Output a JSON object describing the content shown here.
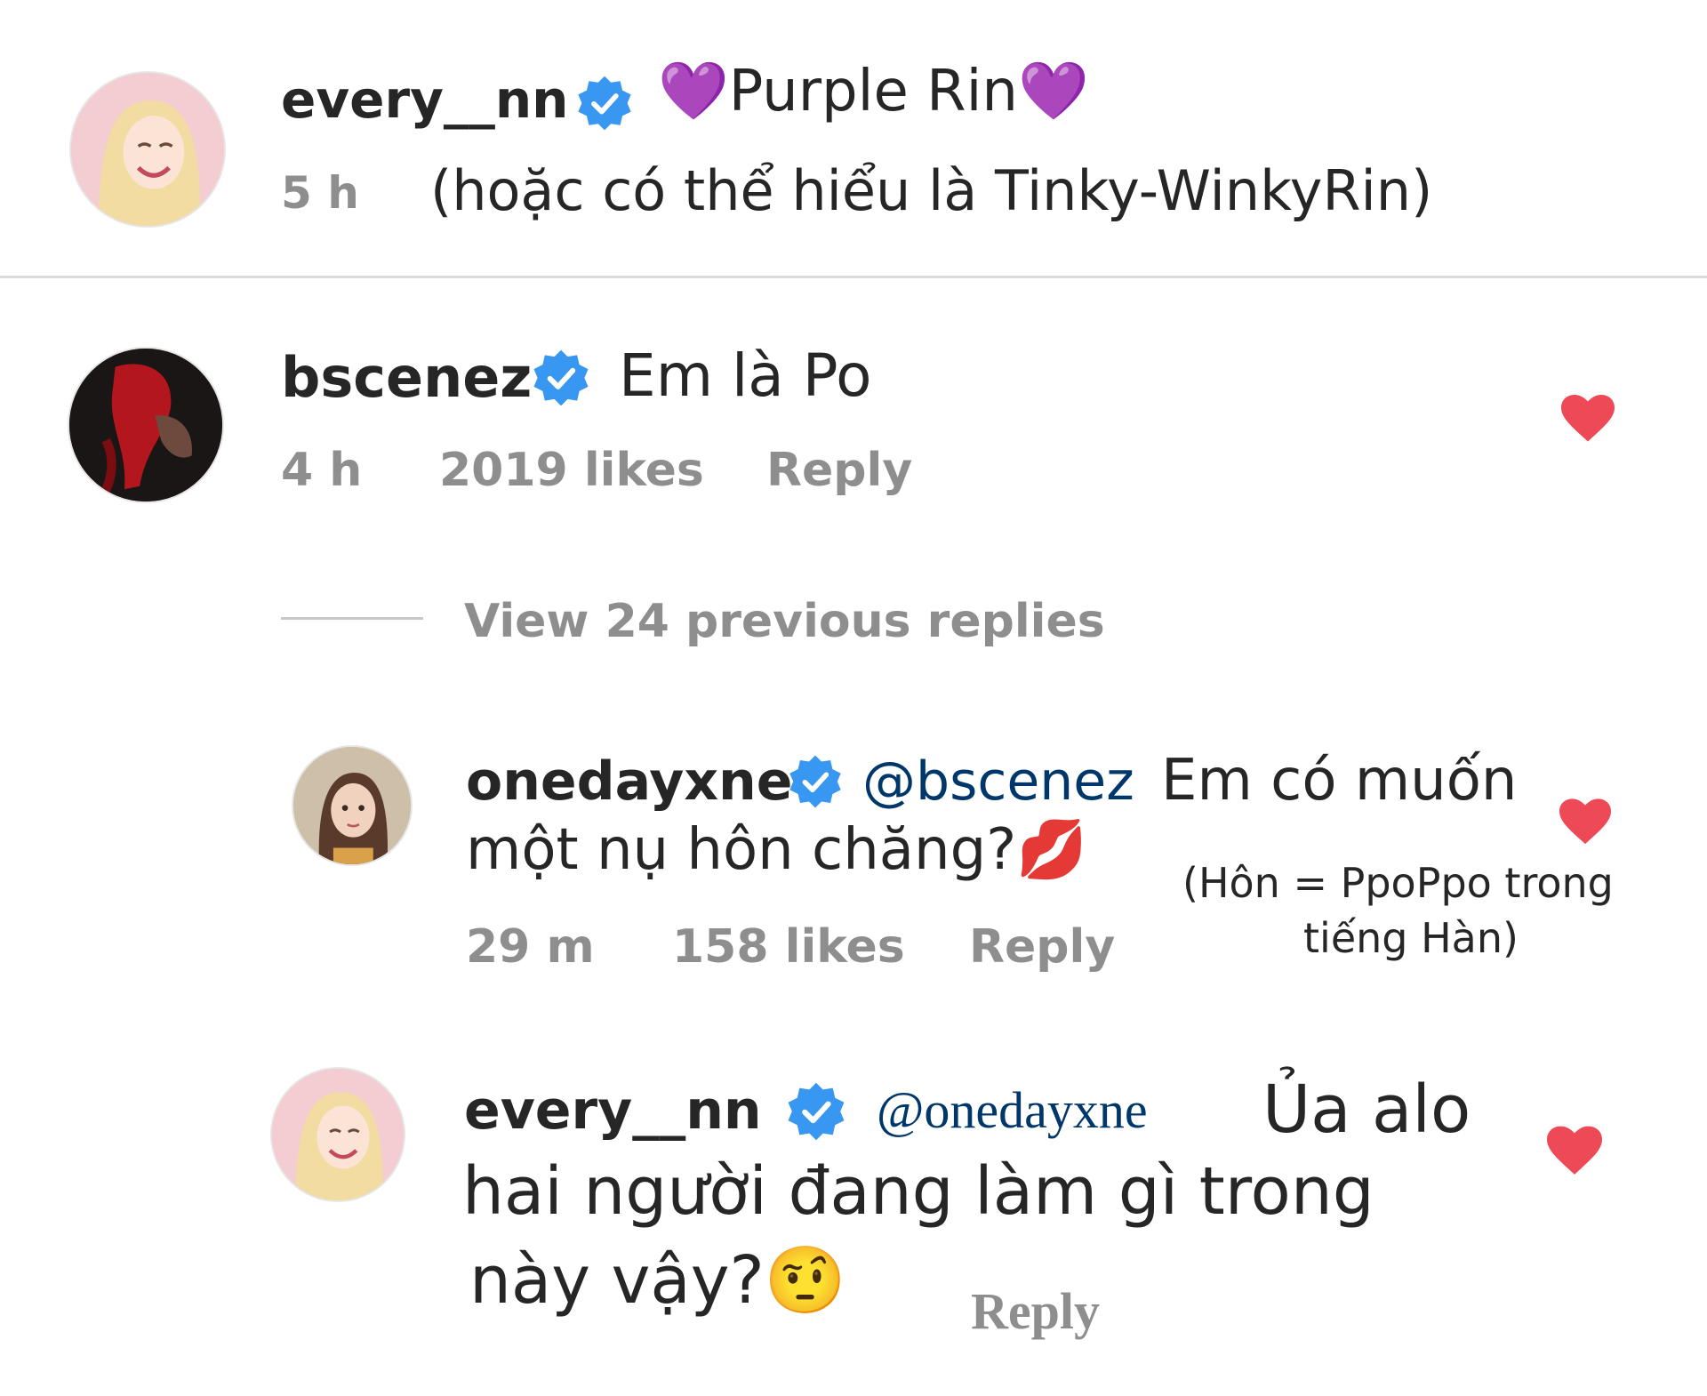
{
  "comments": [
    {
      "username": "every__nn",
      "text": "💜Purple Rin💜",
      "time": "5 h",
      "translation": "(hoặc có thể hiểu là Tinky-WinkyRin)"
    },
    {
      "username": "bscenez",
      "text": "Em là Po",
      "time": "4 h",
      "likes": "2019 likes",
      "reply_label": "Reply",
      "view_replies": "View 24 previous replies"
    }
  ],
  "replies": [
    {
      "username": "onedayxne",
      "mention": "@bscenez",
      "text_line1": "Em có muốn",
      "text_line2": "một nụ hôn chăng?💋",
      "time": "29 m",
      "likes": "158 likes",
      "reply_label": "Reply",
      "note_line1": "(Hôn = PpoPpo trong",
      "note_line2": "tiếng Hàn)"
    },
    {
      "username": "every__nn",
      "mention": "@onedayxne",
      "text_line1": "Ủa alo",
      "text_line2": "hai người đang làm gì trong",
      "text_line3": "này vậy?🤨",
      "reply_label": "Reply"
    }
  ],
  "colors": {
    "verified": "#3897f0",
    "heart": "#ed4956",
    "meta": "#8e8e8e",
    "mention": "#00376b"
  }
}
